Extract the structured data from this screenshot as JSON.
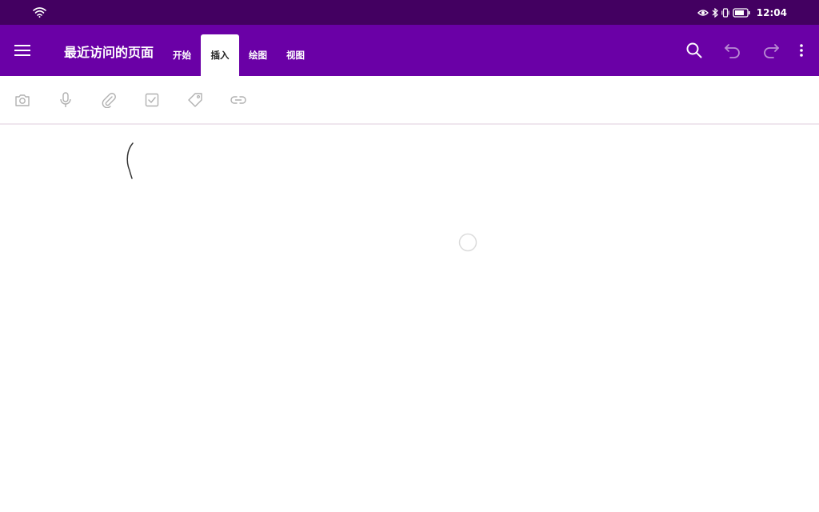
{
  "status_bar": {
    "time": "12:04",
    "icons": [
      "wifi-icon",
      "eye-icon",
      "bluetooth-icon",
      "vibrate-icon",
      "battery-icon"
    ]
  },
  "app_bar": {
    "page_title": "最近访问的页面",
    "tabs": [
      {
        "label": "开始",
        "active": false
      },
      {
        "label": "插入",
        "active": true
      },
      {
        "label": "绘图",
        "active": false
      },
      {
        "label": "视图",
        "active": false
      }
    ],
    "actions": [
      "search-icon",
      "undo-icon",
      "redo-icon",
      "more-vert-icon"
    ],
    "color": "#6a00a6"
  },
  "ribbon": {
    "tools": [
      "camera-icon",
      "microphone-icon",
      "attach-icon",
      "checkbox-icon",
      "tag-icon",
      "link-icon"
    ]
  },
  "colors": {
    "status_bar": "#430061",
    "app_bar": "#6a00a6",
    "tool_gray": "#b0b0b0"
  }
}
